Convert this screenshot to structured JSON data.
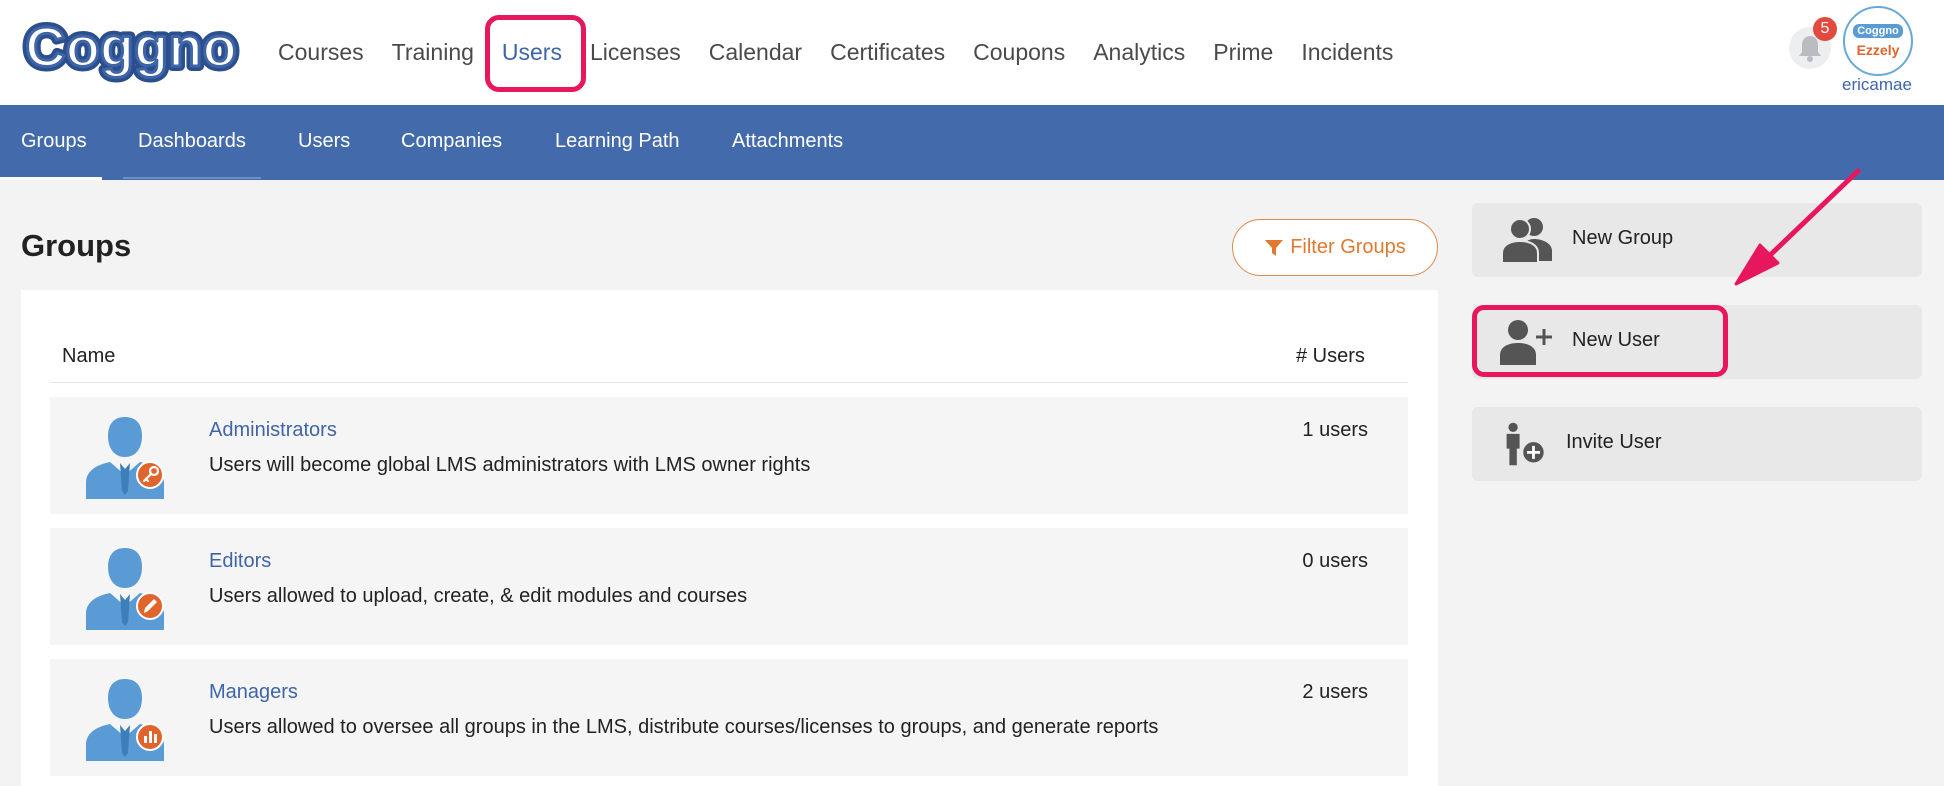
{
  "brand": {
    "logo_text": "Coggno"
  },
  "top_nav": {
    "items": [
      {
        "label": "Courses"
      },
      {
        "label": "Training"
      },
      {
        "label": "Users",
        "active": true
      },
      {
        "label": "Licenses"
      },
      {
        "label": "Calendar"
      },
      {
        "label": "Certificates"
      },
      {
        "label": "Coupons"
      },
      {
        "label": "Analytics"
      },
      {
        "label": "Prime"
      },
      {
        "label": "Incidents"
      }
    ]
  },
  "account": {
    "notification_count": "5",
    "avatar_line1": "Coggno",
    "avatar_line2": "Ezzely",
    "username": "ericamae"
  },
  "sub_nav": {
    "items": [
      {
        "label": "Groups",
        "active": true
      },
      {
        "label": "Dashboards"
      },
      {
        "label": "Users"
      },
      {
        "label": "Companies"
      },
      {
        "label": "Learning Path"
      },
      {
        "label": "Attachments"
      }
    ]
  },
  "main": {
    "title": "Groups",
    "filter_label": "Filter Groups",
    "table": {
      "col_name": "Name",
      "col_users": "# Users",
      "rows": [
        {
          "name": "Administrators",
          "description": "Users will become global LMS administrators with LMS owner rights",
          "count": "1 users",
          "badge_icon": "key-icon"
        },
        {
          "name": "Editors",
          "description": "Users allowed to upload, create, & edit modules and courses",
          "count": "0 users",
          "badge_icon": "pencil-icon"
        },
        {
          "name": "Managers",
          "description": "Users allowed to oversee all groups in the LMS, distribute courses/licenses to groups, and generate reports",
          "count": "2 users",
          "badge_icon": "bar-chart-icon"
        }
      ]
    }
  },
  "sidebar": {
    "new_group_label": "New Group",
    "new_user_label": "New User",
    "invite_user_label": "Invite User"
  },
  "colors": {
    "primary_blue": "#436aab",
    "link_blue": "#3f65a8",
    "accent_orange": "#e07a30",
    "highlight_pink": "#e8175d",
    "user_icon_blue": "#5a9bd5"
  }
}
